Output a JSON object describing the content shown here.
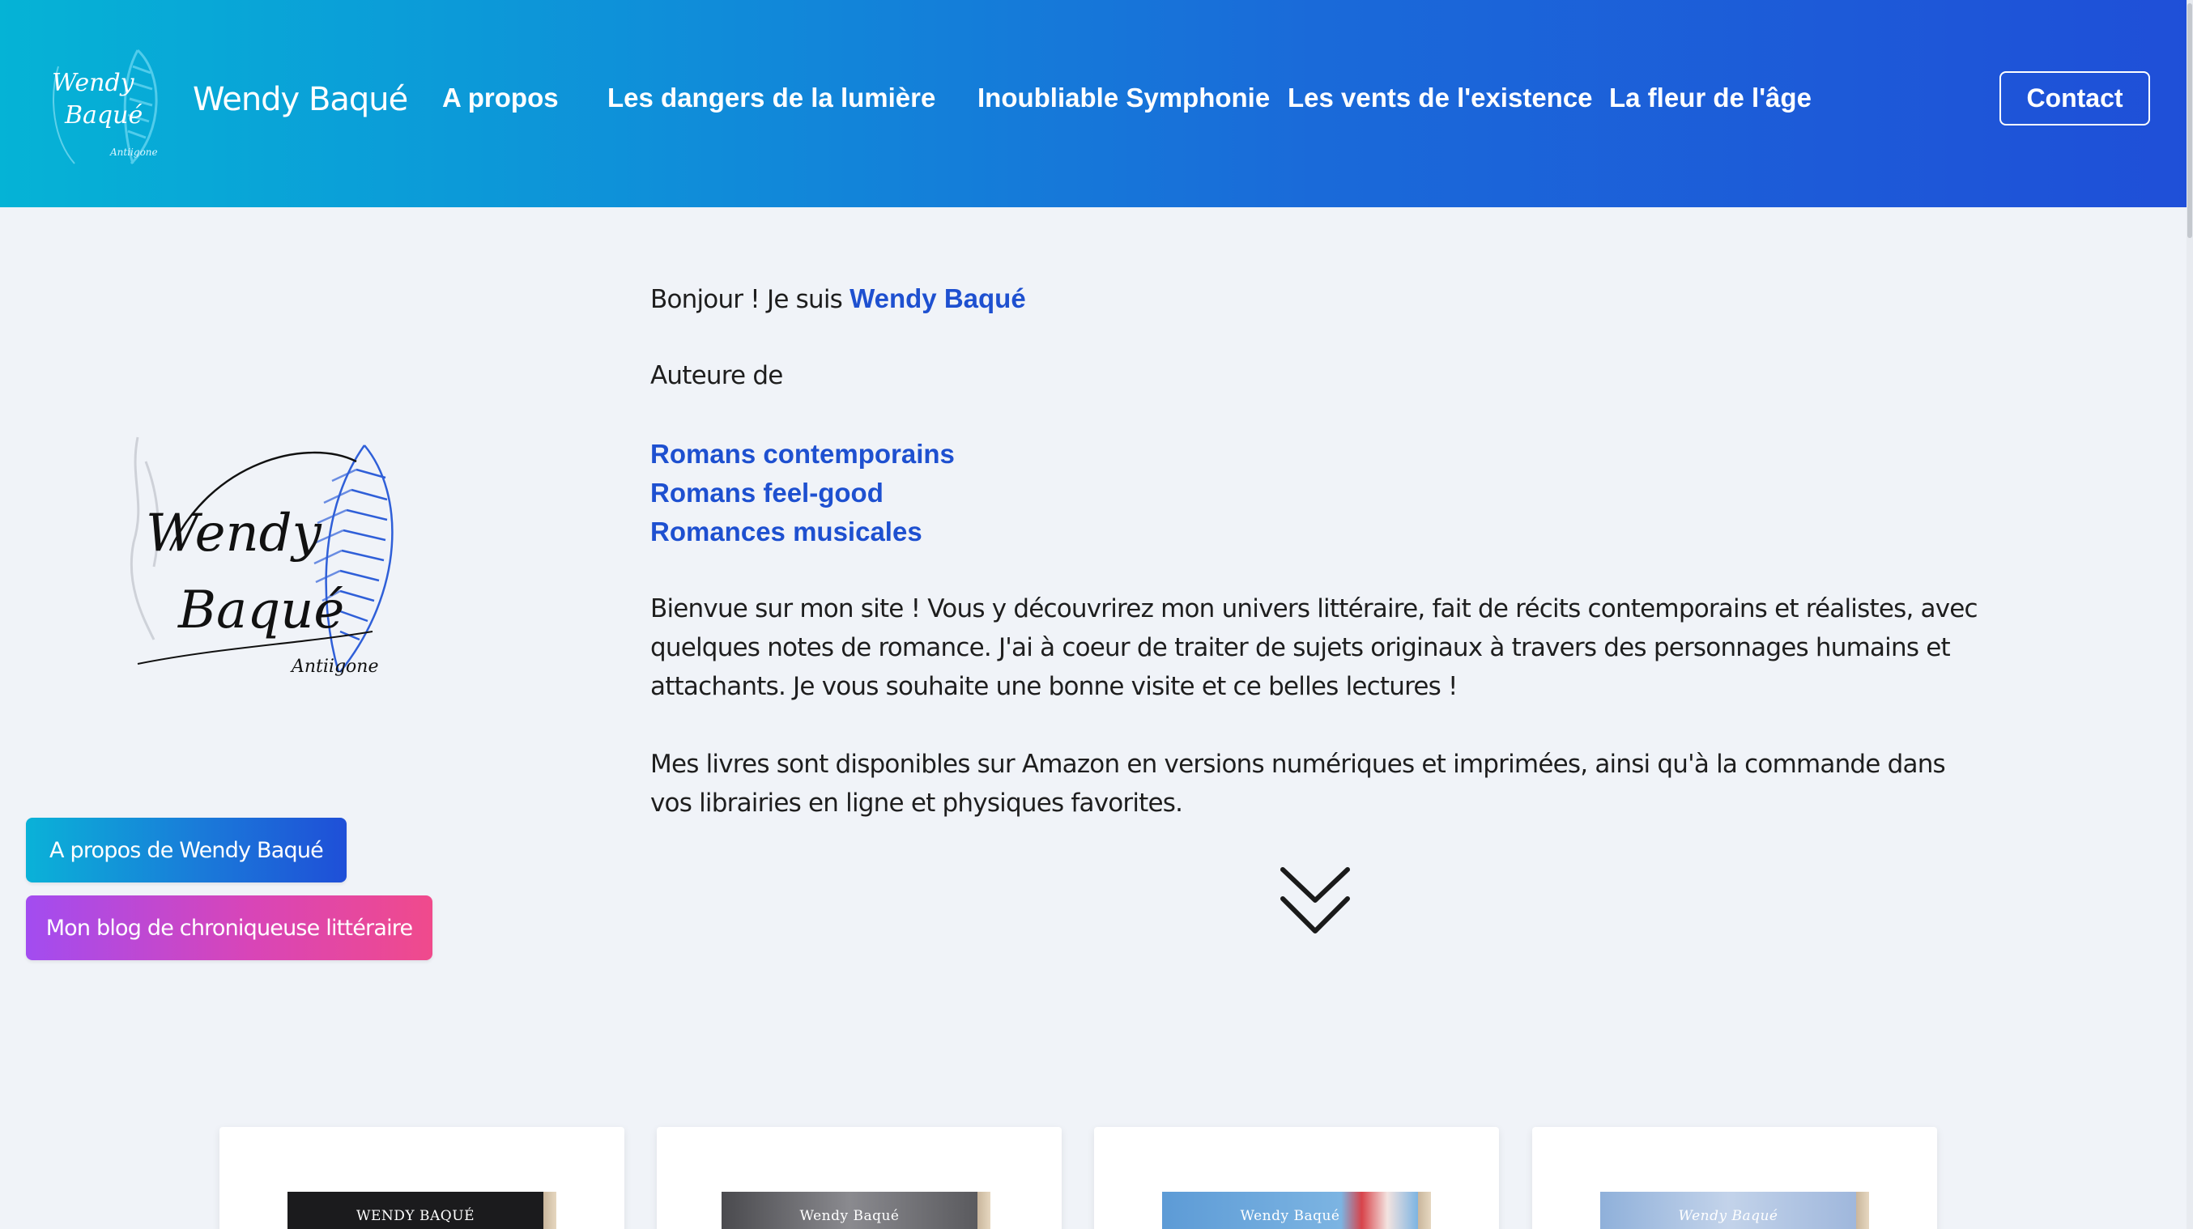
{
  "header": {
    "brand": "Wendy Baqué",
    "logo_text": {
      "line1": "Wendy",
      "line2": "Baqué",
      "line3": "Antiigone"
    },
    "nav": [
      {
        "label": "A propos"
      },
      {
        "label": "Les dangers de la lumière"
      },
      {
        "label": "Inoubliable Symphonie"
      },
      {
        "label": "Les vents de l'existence"
      },
      {
        "label": "La fleur de l'âge"
      }
    ],
    "contact_label": "Contact"
  },
  "sidebar": {
    "logo_text": {
      "line1": "Wendy",
      "line2": "Baqué",
      "line3": "Antiigone"
    },
    "buttons": {
      "about": "A propos de Wendy Baqué",
      "blog": "Mon blog de chroniqueuse littéraire"
    }
  },
  "main": {
    "greeting": "Bonjour ! Je suis ",
    "name": "Wendy Baqué",
    "author_of": "Auteure de",
    "genres": [
      "Romans contemporains",
      "Romans feel-good",
      "Romances musicales"
    ],
    "welcome": "Bienvue sur mon site ! Vous y découvrirez mon univers littéraire, fait de récits contemporains et réalistes, avec quelques notes de romance. J'ai à coeur de traiter de sujets originaux à travers des personnages humains et attachants. Je vous souhaite une bonne visite et ce belles lectures !",
    "availability": "Mes livres sont disponibles sur Amazon en versions numériques et imprimées, ainsi qu'à la commande dans vos librairies en ligne et physiques favorites.",
    "scroll_icon": "double-chevron-down-icon"
  },
  "books": [
    {
      "cover_text": "WENDY BAQUÉ",
      "cover_color": "#1b1b1d",
      "text_color": "#ffffff"
    },
    {
      "cover_text": "Wendy Baqué",
      "cover_color": "#5a5a5e",
      "text_color": "#ffffff"
    },
    {
      "cover_text": "Wendy Baqué",
      "cover_color": "#6aa3d8",
      "text_color": "#ffffff"
    },
    {
      "cover_text": "Wendy Baqué",
      "cover_color": "#9fb7dc",
      "text_color": "#ffffff"
    }
  ],
  "colors": {
    "accent": "#1e50d0",
    "header_gradient_start": "#05b3d6",
    "header_gradient_end": "#1f4fd8",
    "blog_gradient_start": "#a24cf0",
    "blog_gradient_end": "#f04a8c",
    "background": "#f0f3f8"
  }
}
